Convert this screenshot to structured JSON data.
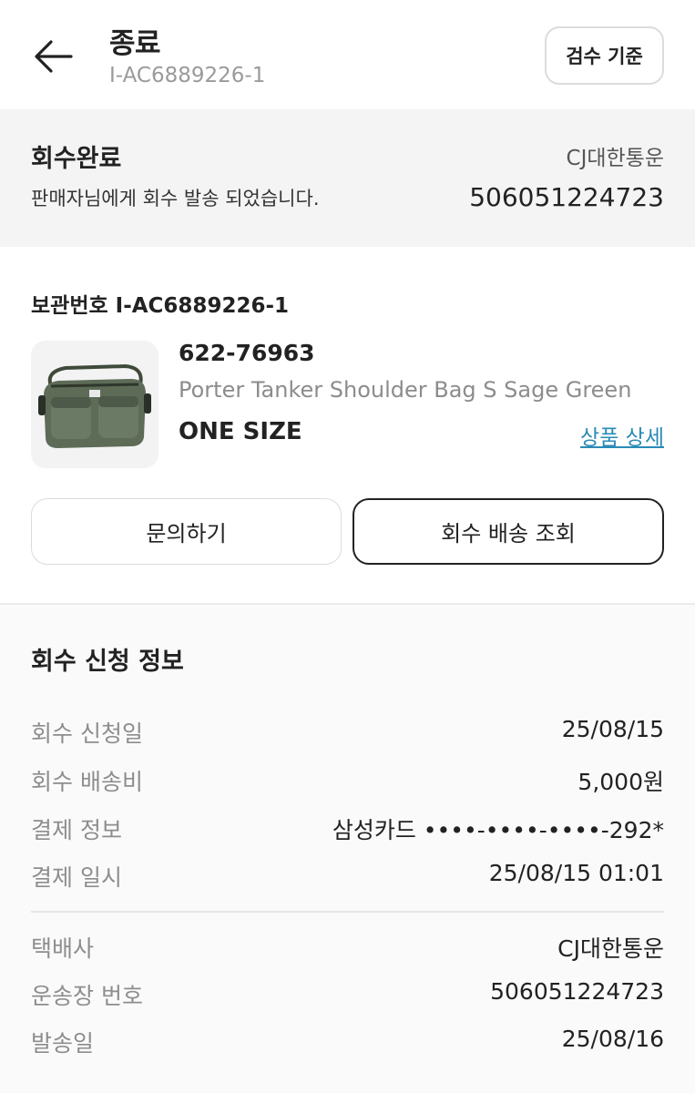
{
  "header": {
    "title": "종료",
    "subtitle": "I-AC6889226-1",
    "inspect_button": "검수 기준"
  },
  "status": {
    "title": "회수완료",
    "description": "판매자님에게 회수 발송 되었습니다.",
    "carrier": "CJ대한통운",
    "tracking_number": "506051224723"
  },
  "storage": {
    "label": "보관번호 I-AC6889226-1"
  },
  "product": {
    "code": "622-76963",
    "name": "Porter Tanker Shoulder Bag S Sage Green",
    "size": "ONE SIZE",
    "detail_link": "상품 상세",
    "image_icon": "bag-image"
  },
  "actions": {
    "inquiry": "문의하기",
    "track": "회수 배송 조회"
  },
  "return_info": {
    "title": "회수 신청 정보",
    "rows": [
      {
        "label": "회수 신청일",
        "value": "25/08/15"
      },
      {
        "label": "회수 배송비",
        "value": "5,000원"
      },
      {
        "label": "결제 정보",
        "value": "삼성카드 ••••-••••-••••-292*"
      },
      {
        "label": "결제 일시",
        "value": "25/08/15 01:01"
      }
    ],
    "shipping_rows": [
      {
        "label": "택배사",
        "value": "CJ대한통운"
      },
      {
        "label": "운송장 번호",
        "value": "506051224723"
      },
      {
        "label": "발송일",
        "value": "25/08/16"
      }
    ]
  },
  "colors": {
    "link": "#2a8bb6",
    "banner_bg": "#f4f4f4",
    "section_bg": "#fafafa"
  }
}
